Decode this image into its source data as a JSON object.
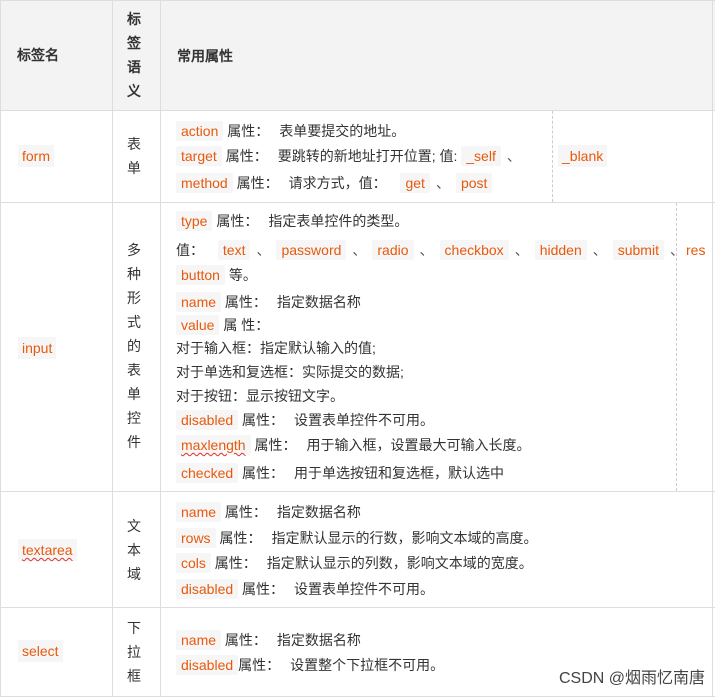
{
  "header": {
    "col1": "标签名",
    "col2_chars": [
      "标",
      "签",
      "语",
      "义"
    ],
    "col3": "常用属性"
  },
  "rows": {
    "form": {
      "tag": "form",
      "semantic_chars": [
        "表",
        "单"
      ],
      "l1_code": "action",
      "l1_label": "属性：",
      "l1_desc": "表单要提交的地址。",
      "l2_code": "target",
      "l2_label": "属性：",
      "l2_desc": "要跳转的新地址打开位置; 值:",
      "l2_v1": "_self",
      "l2_v2": "_blank",
      "l3_code": "method",
      "l3_label": "属性：",
      "l3_desc": "请求方式，值：",
      "l3_v1": "get",
      "l3_v2": "post"
    },
    "input": {
      "tag": "input",
      "semantic_chars": [
        "多",
        "种",
        "形",
        "式",
        "的",
        "表",
        "单",
        "控",
        "件"
      ],
      "l1_code": "type",
      "l1_label": "属性：",
      "l1_desc": "指定表单控件的类型。",
      "l2_prefix": "值：",
      "values": [
        "text",
        "password",
        "radio",
        "checkbox",
        "hidden",
        "submit",
        "res"
      ],
      "l3_code": "button",
      "l3_suffix": "等。",
      "l4_code": "name",
      "l4_label": "属性：",
      "l4_desc": "指定数据名称",
      "l5_code": "value",
      "l5_label": "属 性：",
      "l6": "对于输入框：指定默认输入的值;",
      "l7": "对于单选和复选框：实际提交的数据;",
      "l8": "对于按钮：显示按钮文字。",
      "l9_code": "disabled",
      "l9_label": "属性：",
      "l9_desc": "设置表单控件不可用。",
      "l10_code": "maxlength",
      "l10_label": "属性：",
      "l10_desc": "用于输入框，设置最大可输入长度。",
      "l11_code": "checked",
      "l11_label": "属性：",
      "l11_desc": "用于单选按钮和复选框，默认选中"
    },
    "textarea": {
      "tag": "textarea",
      "semantic_chars": [
        "文",
        "本",
        "域"
      ],
      "l1_code": "name",
      "l1_label": "属性：",
      "l1_desc": "指定数据名称",
      "l2_code": "rows",
      "l2_label": "属性：",
      "l2_desc": "指定默认显示的行数，影响文本域的高度。",
      "l3_code": "cols",
      "l3_label": "属性：",
      "l3_desc": "指定默认显示的列数，影响文本域的宽度。",
      "l4_code": "disabled",
      "l4_label": "属性：",
      "l4_desc": "设置表单控件不可用。"
    },
    "select": {
      "tag": "select",
      "semantic_chars": [
        "下",
        "拉",
        "框"
      ],
      "l1_code": "name",
      "l1_label": "属性：",
      "l1_desc": "指定数据名称",
      "l2_code": "disabled",
      "l2_label": "属性：",
      "l2_desc": "设置整个下拉框不可用。"
    }
  },
  "separator": "、",
  "watermark": "CSDN @烟雨忆南唐",
  "colors": {
    "code_text": "#e8590c",
    "code_bg": "#f6f6f6",
    "border": "#dddddd",
    "header_bg": "#f3f3f3"
  }
}
